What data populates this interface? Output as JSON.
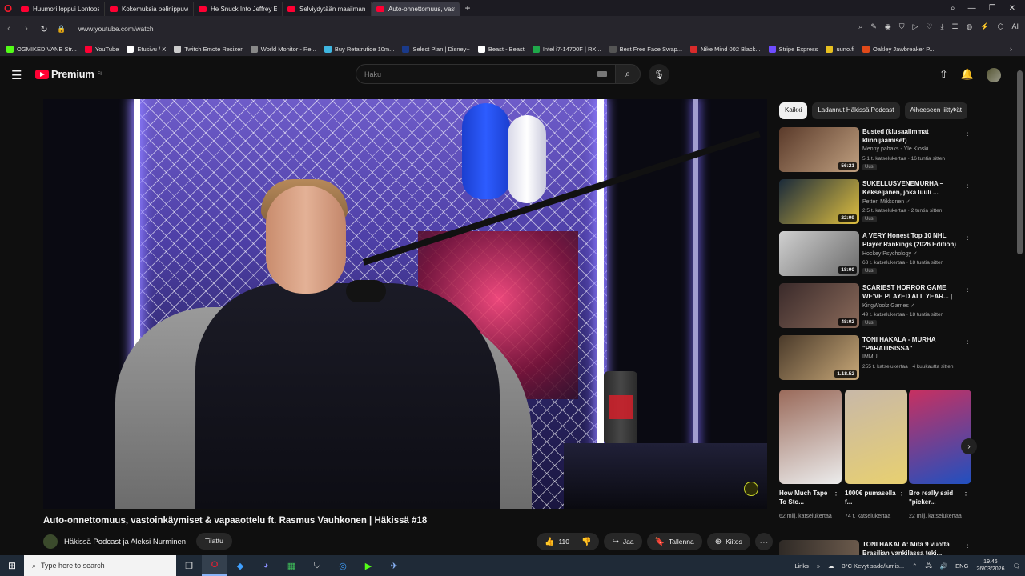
{
  "browser": {
    "tabs": [
      {
        "title": "Huumori loppui Lontoossa",
        "active": false
      },
      {
        "title": "Kokemuksia peliriippuvuudesta",
        "active": false
      },
      {
        "title": "He Snuck Into Jeffrey Epstein",
        "active": false
      },
      {
        "title": "Selviydytään maailman vaikeimmista",
        "active": false
      },
      {
        "title": "Auto-onnettomuus, vastoinkäymiset",
        "active": true
      }
    ],
    "new_tab": "+",
    "url": "www.youtube.com/watch",
    "ai_label": "AI",
    "bookmarks": [
      {
        "label": "OGMIKEDIVANE Str...",
        "color": "#53fc18"
      },
      {
        "label": "YouTube",
        "color": "#ff0033"
      },
      {
        "label": "Etusivu / X",
        "color": "#ffffff"
      },
      {
        "label": "Twitch Emote Resizer",
        "color": "#cccccc"
      },
      {
        "label": "World Monitor - Re...",
        "color": "#888888"
      },
      {
        "label": "Buy Retatrutide 10m...",
        "color": "#3fb6e0"
      },
      {
        "label": "Select Plan | Disney+",
        "color": "#1a3a8a"
      },
      {
        "label": "Beast - Beast",
        "color": "#ffffff"
      },
      {
        "label": "Intel i7-14700F | RX...",
        "color": "#1fa84a"
      },
      {
        "label": "Best Free Face Swap...",
        "color": "#555555"
      },
      {
        "label": "Nike Mind 002 Black...",
        "color": "#d92b2b"
      },
      {
        "label": "Stripe Express",
        "color": "#6f4dff"
      },
      {
        "label": "uuno.fi",
        "color": "#e8c020"
      },
      {
        "label": "Oakley Jawbreaker P...",
        "color": "#e04a1a"
      }
    ]
  },
  "youtube": {
    "logo_text": "Premium",
    "logo_region": "FI",
    "search_placeholder": "Haku",
    "video": {
      "title": "Auto-onnettomuus, vastoinkäymiset & vapaaottelu ft. Rasmus Vauhkonen | Häkissä #18",
      "channel": "Häkissä Podcast ja Aleksi Nurminen",
      "subscribe_label": "Tilattu",
      "likes": "110",
      "share_label": "Jaa",
      "save_label": "Tallenna",
      "thanks_label": "Kiitos"
    },
    "chips": [
      {
        "label": "Kaikki",
        "selected": true
      },
      {
        "label": "Ladannut Häkissä Podcast",
        "selected": false
      },
      {
        "label": "Aiheeseen liittyvät",
        "selected": false
      }
    ],
    "recommendations": [
      {
        "title": "Busted (klusaalimmat klinnijäämiset)",
        "channel": "Menny pahaks - Yle Kioski",
        "meta": "5,1 t. katselukertaa · 16 tuntia sitten",
        "duration": "56:21",
        "badge": "Uusi",
        "thumb": [
          "#5a3a2a",
          "#c0a080"
        ]
      },
      {
        "title": "SUKELLUSVENEMURHA – Kekseljänen, joka luuli ...",
        "channel": "Petteri Mikkonen ✓",
        "meta": "2,5 t. katselukertaa · 2 tuntia sitten",
        "duration": "22:09",
        "badge": "Uusi",
        "thumb": [
          "#1a2a3a",
          "#e0c040"
        ]
      },
      {
        "title": "A VERY Honest Top 10 NHL Player Rankings (2026 Edition)",
        "channel": "Hockey Psychology ✓",
        "meta": "63 t. katselukertaa · 18 tuntia sitten",
        "duration": "18:00",
        "badge": "Uusi",
        "thumb": [
          "#d0d0d0",
          "#6a6a6a"
        ]
      },
      {
        "title": "SCARIEST HORROR GAME WE'VE PLAYED ALL YEAR... | ...",
        "channel": "KingWoolz Games ✓",
        "meta": "49 t. katselukertaa · 18 tuntia sitten",
        "duration": "48:02",
        "badge": "Uusi",
        "thumb": [
          "#3a2a2a",
          "#8a6a5a"
        ]
      },
      {
        "title": "TONI HAKALA - MURHA \"PARATIISISSA\"",
        "channel": "IMMU",
        "meta": "255 t. katselukertaa · 4 kuukautta sitten",
        "duration": "1.18.52",
        "badge": "",
        "thumb": [
          "#4a3a2a",
          "#c8a878"
        ]
      }
    ],
    "shorts": [
      {
        "title": "How Much Tape To Sto...",
        "meta": "62 milj. katselukertaa",
        "thumb": [
          "#9a6a5a",
          "#ececec"
        ]
      },
      {
        "title": "1000€ pumasella f...",
        "meta": "74 t. katselukertaa",
        "thumb": [
          "#c8b8a8",
          "#e8d070"
        ]
      },
      {
        "title": "Bro really said \"picker...",
        "meta": "22 milj. katselukertaa",
        "thumb": [
          "#c83060",
          "#2050c0"
        ]
      }
    ],
    "next_rec": {
      "title": "TONI HAKALA: Mitä 9 vuotta Brasilian vankilassa teki..."
    }
  },
  "taskbar": {
    "search_placeholder": "Type here to search",
    "links_label": "Links",
    "weather": "3°C Kevyt sade/lumis...",
    "lang": "ENG",
    "time": "19.46",
    "date": "26/03/2026"
  }
}
